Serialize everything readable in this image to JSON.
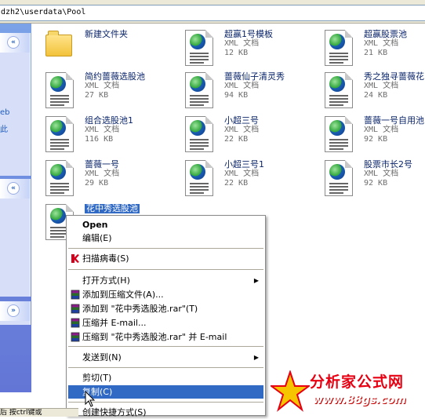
{
  "address_bar": {
    "path": "dzh2\\userdata\\Pool"
  },
  "task_pane": {
    "panel1_text": [
      "eb",
      "此"
    ],
    "chevron_up": "«",
    "chevron_down": "»"
  },
  "files": [
    {
      "name": "新建文件夹",
      "type": "",
      "size": "",
      "kind": "folder"
    },
    {
      "name": "超赢1号模板",
      "type": "XML 文档",
      "size": "12 KB",
      "kind": "xml"
    },
    {
      "name": "超赢股票池",
      "type": "XML 文档",
      "size": "21 KB",
      "kind": "xml"
    },
    {
      "name": "简约蔷薇选股池",
      "type": "XML 文档",
      "size": "27 KB",
      "kind": "xml"
    },
    {
      "name": "蔷薇仙子清灵秀",
      "type": "XML 文档",
      "size": "94 KB",
      "kind": "xml"
    },
    {
      "name": "秀之独寻蔷薇花",
      "type": "XML 文档",
      "size": "24 KB",
      "kind": "xml"
    },
    {
      "name": "组合选股池1",
      "type": "XML 文档",
      "size": "116 KB",
      "kind": "xml"
    },
    {
      "name": "小超三号",
      "type": "XML 文档",
      "size": "22 KB",
      "kind": "xml"
    },
    {
      "name": "蔷薇一号自用池",
      "type": "XML 文档",
      "size": "92 KB",
      "kind": "xml"
    },
    {
      "name": "蔷薇一号",
      "type": "XML 文档",
      "size": "29 KB",
      "kind": "xml"
    },
    {
      "name": "小超三号1",
      "type": "XML 文档",
      "size": "22 KB",
      "kind": "xml"
    },
    {
      "name": "股票市长2号",
      "type": "XML 文档",
      "size": "92 KB",
      "kind": "xml"
    },
    {
      "name": "花中秀选股池",
      "type": "",
      "size": "",
      "kind": "xml",
      "selected": true
    }
  ],
  "context_menu": {
    "items": [
      {
        "label": "Open",
        "bold": true
      },
      {
        "label": "编辑(E)"
      },
      {
        "label": "扫描病毒(S)",
        "icon": "kaspersky-icon"
      },
      {
        "label": "打开方式(H)",
        "submenu": true
      },
      {
        "label": "添加到压缩文件(A)...",
        "icon": "winrar-icon"
      },
      {
        "label": "添加到 \"花中秀选股池.rar\"(T)",
        "icon": "winrar-icon"
      },
      {
        "label": "压缩并 E-mail...",
        "icon": "winrar-icon"
      },
      {
        "label": "压缩到 \"花中秀选股池.rar\" 并 E-mail",
        "icon": "winrar-icon"
      },
      {
        "label": "发送到(N)",
        "submenu": true
      },
      {
        "label": "剪切(T)"
      },
      {
        "label": "复制(C)",
        "highlighted": true
      },
      {
        "label": "创建快捷方式(S)"
      }
    ]
  },
  "status_bar": {
    "text": "后  按ctrl键或"
  },
  "watermark": {
    "title": "分析家公式网",
    "url": "www.88gs.com"
  },
  "colors": {
    "selection": "#316ac5",
    "pane_bg": "#d6dff7",
    "file_name": "#0a246a"
  }
}
